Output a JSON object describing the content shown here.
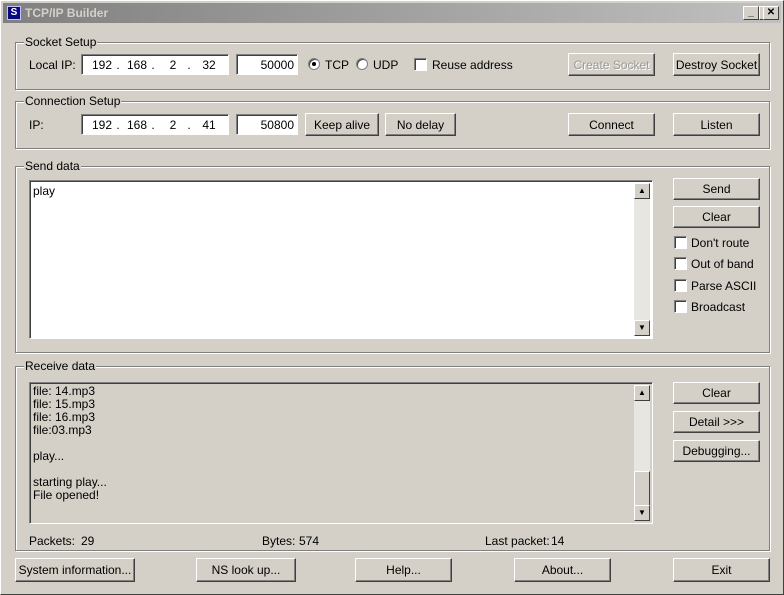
{
  "window": {
    "title": "TCP/IP Builder",
    "icon": "S"
  },
  "socket_setup": {
    "legend": "Socket Setup",
    "local_ip_label": "Local IP:",
    "ip": [
      "192",
      "168",
      "2",
      "32"
    ],
    "port": "50000",
    "tcp_label": "TCP",
    "udp_label": "UDP",
    "protocol_selected": "TCP",
    "reuse_label": "Reuse address",
    "create_label": "Create Socket",
    "destroy_label": "Destroy Socket"
  },
  "connection_setup": {
    "legend": "Connection Setup",
    "ip_label": "IP:",
    "ip": [
      "192",
      "168",
      "2",
      "41"
    ],
    "port": "50800",
    "keepalive_label": "Keep alive",
    "nodelay_label": "No delay",
    "connect_label": "Connect",
    "listen_label": "Listen"
  },
  "send_data": {
    "legend": "Send data",
    "text": "play",
    "send_label": "Send",
    "clear_label": "Clear",
    "options": [
      "Don't route",
      "Out of band",
      "Parse ASCII",
      "Broadcast"
    ]
  },
  "receive_data": {
    "legend": "Receive data",
    "lines": [
      "file: 14.mp3",
      "file: 15.mp3",
      "file: 16.mp3",
      "file:03.mp3",
      "",
      "play...",
      "",
      "starting play...",
      "File opened!"
    ],
    "clear_label": "Clear",
    "detail_label": "Detail >>>",
    "debugging_label": "Debugging...",
    "packets_label": "Packets:",
    "packets_value": "29",
    "bytes_label": "Bytes:",
    "bytes_value": "574",
    "last_packet_label": "Last packet:",
    "last_packet_value": "14"
  },
  "footer": {
    "sysinfo_label": "System information...",
    "nslookup_label": "NS look up...",
    "help_label": "Help...",
    "about_label": "About...",
    "exit_label": "Exit"
  }
}
